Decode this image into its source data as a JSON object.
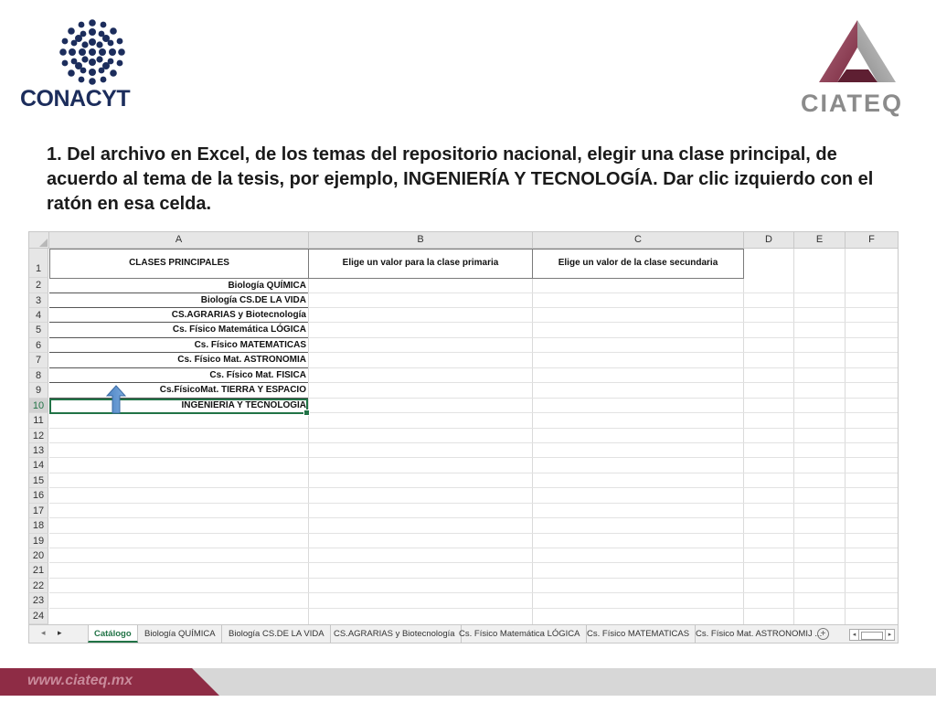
{
  "logos": {
    "left": "CONACYT",
    "right": "CIATEQ"
  },
  "instruction": {
    "text": "1.   Del archivo en Excel, de los temas del repositorio nacional, elegir una clase principal, de acuerdo al tema de la tesis, por ejemplo, INGENIERÍA Y TECNOLOGÍA. Dar clic izquierdo con el ratón en esa celda."
  },
  "spreadsheet": {
    "columns": [
      "A",
      "B",
      "C",
      "D",
      "E",
      "F"
    ],
    "rows": [
      "1",
      "2",
      "3",
      "4",
      "5",
      "6",
      "7",
      "8",
      "9",
      "10",
      "11",
      "12",
      "13",
      "14",
      "15",
      "16",
      "17",
      "18",
      "19",
      "20",
      "21",
      "22",
      "23",
      "24"
    ],
    "headers": {
      "a1": "CLASES PRINCIPALES",
      "b1": "Elige un valor para la clase primaria",
      "c1": "Elige un valor de la clase secundaria"
    },
    "classes": [
      "Biología QUÍMICA",
      "Biología CS.DE LA VIDA",
      "CS.AGRARIAS y Biotecnología",
      "Cs. Físico Matemática LÓGICA",
      "Cs. Físico MATEMATICAS",
      "Cs. Físico Mat. ASTRONOMIA",
      "Cs. Físico Mat. FISICA",
      "Cs.FísicoMat. TIERRA Y ESPACIO",
      "INGENIERÍA Y TECNOLOGÍA"
    ],
    "selected_cell": "A10",
    "accent_color": "#217346"
  },
  "tabs": {
    "nav_prev": "◂",
    "nav_next": "▸",
    "items": [
      "Catálogo",
      "Biología QUÍMICA",
      "Biología CS.DE LA VIDA",
      "CS.AGRARIAS y Biotecnología",
      "Cs. Físico Matemática LÓGICA",
      "Cs. Físico MATEMATICAS",
      "Cs. Físico Mat. ASTRONOMIJ ..."
    ],
    "active": "Catálogo",
    "add_icon": "+"
  },
  "footer": {
    "url": "www.ciateq.mx",
    "brand_color": "#8e2c45"
  }
}
